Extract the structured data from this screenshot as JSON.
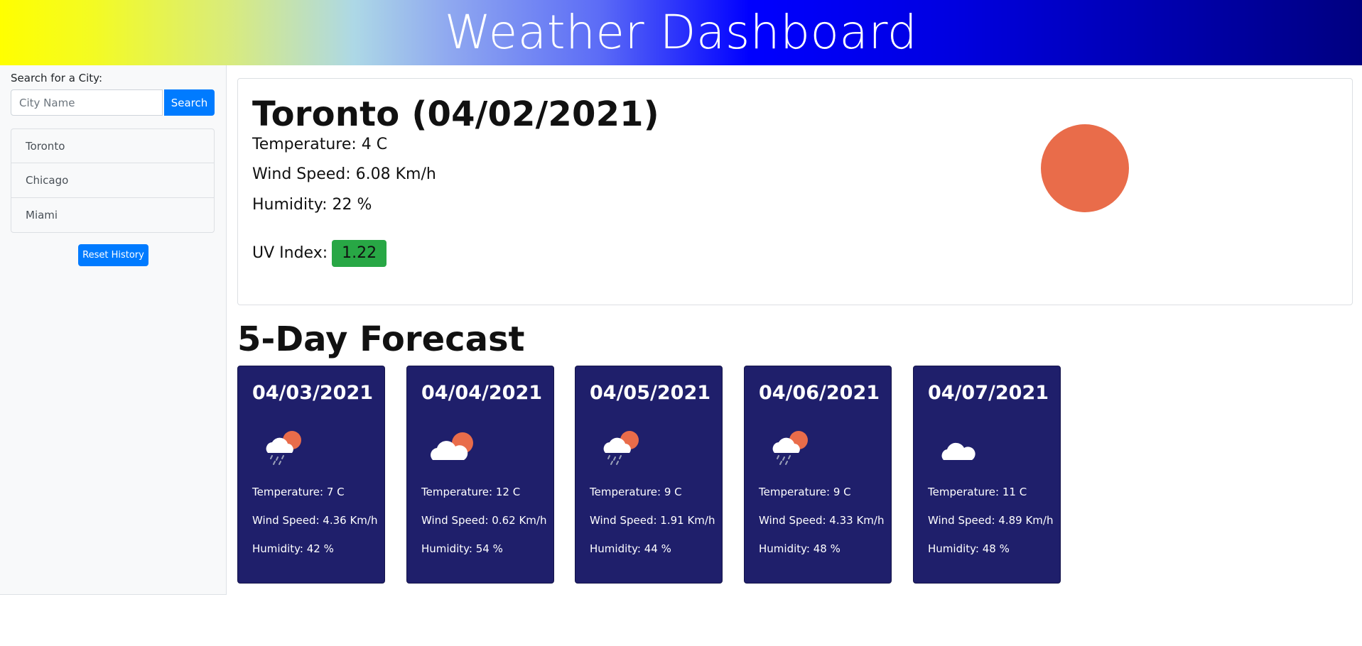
{
  "header": {
    "title": "Weather Dashboard"
  },
  "sidebar": {
    "search_label": "Search for a City:",
    "search_placeholder": "City Name",
    "search_button": "Search",
    "history": [
      "Toronto",
      "Chicago",
      "Miami"
    ],
    "reset_button": "Reset History"
  },
  "current": {
    "title": "Toronto (04/02/2021)",
    "temperature": "Temperature: 4 C",
    "wind": "Wind Speed: 6.08 Km/h",
    "humidity": "Humidity: 22 %",
    "uv_label": "UV Index:",
    "uv_value": "1.22",
    "icon": "sun-icon"
  },
  "forecast": {
    "heading": "5-Day Forecast",
    "days": [
      {
        "date": "04/03/2021",
        "icon": "rain-sun-icon",
        "temperature": "Temperature: 7 C",
        "wind": "Wind Speed: 4.36 Km/h",
        "humidity": "Humidity: 42 %"
      },
      {
        "date": "04/04/2021",
        "icon": "cloud-sun-icon",
        "temperature": "Temperature: 12 C",
        "wind": "Wind Speed: 0.62 Km/h",
        "humidity": "Humidity: 54 %"
      },
      {
        "date": "04/05/2021",
        "icon": "rain-sun-icon",
        "temperature": "Temperature: 9 C",
        "wind": "Wind Speed: 1.91 Km/h",
        "humidity": "Humidity: 44 %"
      },
      {
        "date": "04/06/2021",
        "icon": "rain-sun-icon",
        "temperature": "Temperature: 9 C",
        "wind": "Wind Speed: 4.33 Km/h",
        "humidity": "Humidity: 48 %"
      },
      {
        "date": "04/07/2021",
        "icon": "cloud-icon",
        "temperature": "Temperature: 11 C",
        "wind": "Wind Speed: 4.89 Km/h",
        "humidity": "Humidity: 48 %"
      }
    ]
  },
  "colors": {
    "accent": "#007bff",
    "uv_good": "#28a745",
    "forecast_card": "#1f1f6b",
    "sun": "#e96c4a"
  }
}
